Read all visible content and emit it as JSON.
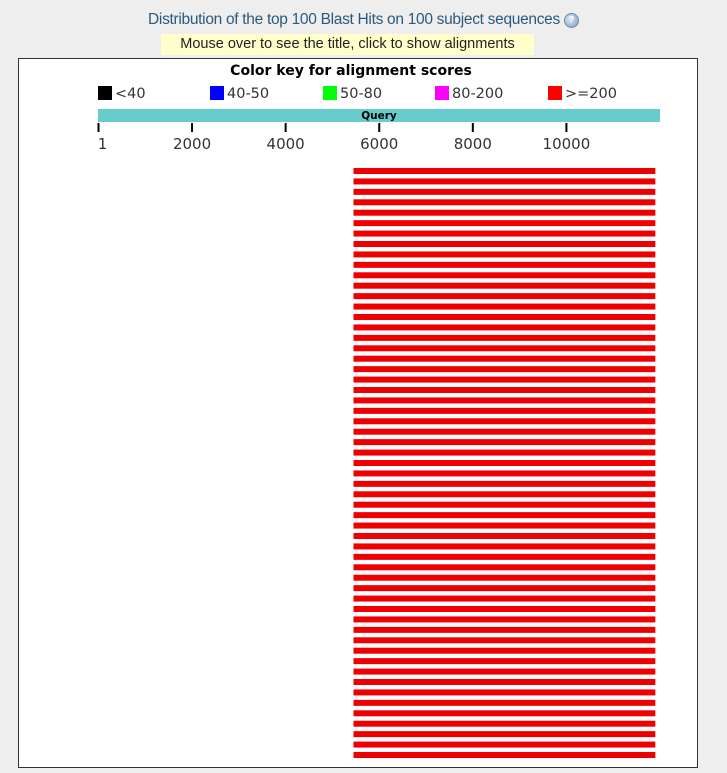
{
  "header": {
    "title": "Distribution of the top 100 Blast Hits on 100 subject sequences",
    "help_icon": "question-help-icon",
    "hint": "Mouse over to see the title, click to show alignments"
  },
  "color_key": {
    "title": "Color key for alignment scores",
    "items": [
      {
        "label": "<40",
        "color": "#000000"
      },
      {
        "label": "40-50",
        "color": "#0000ff"
      },
      {
        "label": "50-80",
        "color": "#00ff00"
      },
      {
        "label": "80-200",
        "color": "#ff00ff"
      },
      {
        "label": ">=200",
        "color": "#ff0000"
      }
    ]
  },
  "query_bar": {
    "label": "Query",
    "color": "#66cccc"
  },
  "axis": {
    "min": 1,
    "max": 12000,
    "ticks": [
      {
        "label": "1",
        "value": 1
      },
      {
        "label": "2000",
        "value": 2000
      },
      {
        "label": "4000",
        "value": 4000
      },
      {
        "label": "6000",
        "value": 6000
      },
      {
        "label": "8000",
        "value": 8000
      },
      {
        "label": "10000",
        "value": 10000
      }
    ]
  },
  "hits": {
    "count": 100,
    "visible_rows": 57,
    "start": 5450,
    "end": 11900,
    "score_class": ">=200",
    "color": "#ee0000"
  }
}
